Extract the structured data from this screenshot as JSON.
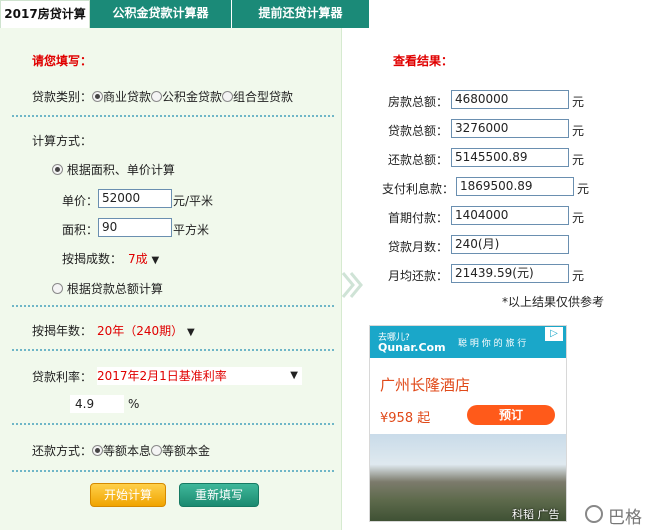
{
  "tabs": [
    "2017房贷计算器",
    "公积金贷款计算器",
    "提前还贷计算器"
  ],
  "left": {
    "heading": "请您填写：",
    "loan_type": {
      "label": "贷款类别：",
      "options": [
        "商业贷款",
        "公积金贷款",
        "组合型贷款"
      ],
      "selected": 0
    },
    "calc_method": {
      "label": "计算方式：",
      "option1": "根据面积、单价计算",
      "option2": "根据贷款总额计算"
    },
    "unit_price": {
      "label": "单价：",
      "value": "52000",
      "unit": "元/平米"
    },
    "area": {
      "label": "面积：",
      "value": "90",
      "unit": "平方米"
    },
    "ratio": {
      "label": "按揭成数：",
      "value": "7成"
    },
    "years": {
      "label": "按揭年数：",
      "value": "20年（240期）"
    },
    "rate": {
      "label": "贷款利率：",
      "value": "2017年2月1日基准利率",
      "number": "4.9",
      "percent": "%"
    },
    "repay": {
      "label": "还款方式：",
      "options": [
        "等额本息",
        "等额本金"
      ],
      "selected": 0
    },
    "buttons": {
      "start": "开始计算",
      "reset": "重新填写"
    }
  },
  "right": {
    "heading": "查看结果：",
    "rows": [
      {
        "label": "房款总额：",
        "value": "4680000",
        "unit": "元"
      },
      {
        "label": "贷款总额：",
        "value": "3276000",
        "unit": "元"
      },
      {
        "label": "还款总额：",
        "value": "5145500.89",
        "unit": "元"
      },
      {
        "label": "支付利息款：",
        "value": "1869500.89",
        "unit": "元"
      },
      {
        "label": "首期付款：",
        "value": "1404000",
        "unit": "元"
      },
      {
        "label": "贷款月数：",
        "value": "240(月)",
        "unit": ""
      },
      {
        "label": "月均还款：",
        "value": "21439.59(元)",
        "unit": "元"
      }
    ],
    "note": "*以上结果仅供参考"
  },
  "ad": {
    "brand_small": "去哪儿?",
    "brand": "Qunar.Com",
    "slogan": "聪 明 你 的 旅 行",
    "hotel": "广州长隆酒店",
    "price": "¥958 起",
    "book": "预订",
    "footer": "科韬 广告"
  },
  "watermark": "巴格",
  "colors": {
    "tab_bg": "#1b8a78",
    "panel_bg": "#f1f9ec",
    "red": "#e00000",
    "btn_start": "#f0a400",
    "btn_reset": "#1b8a70"
  }
}
